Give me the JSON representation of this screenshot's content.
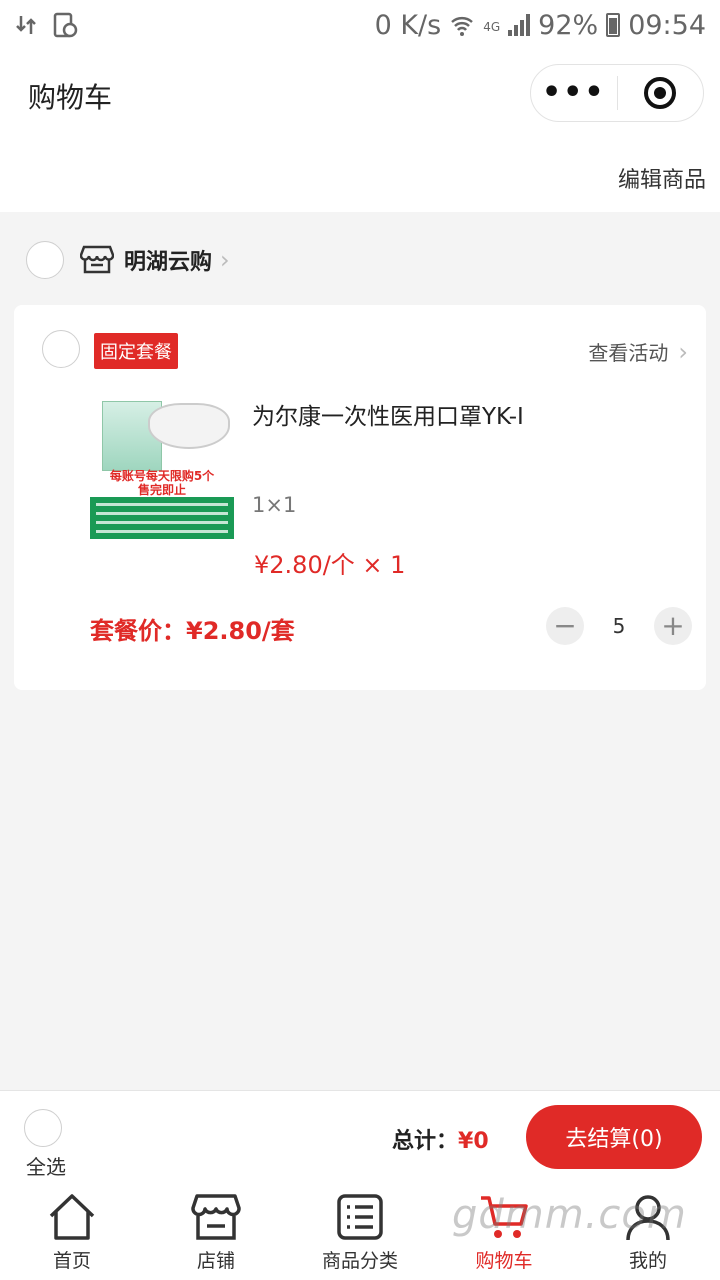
{
  "status_bar": {
    "speed": "0 K/s",
    "network": "4G",
    "battery": "92%",
    "time": "09:54"
  },
  "header": {
    "title": "购物车",
    "more_label": "•••",
    "edit_label": "编辑商品"
  },
  "shop": {
    "name": "明湖云购"
  },
  "package": {
    "badge": "固定套餐",
    "activity_link": "查看活动",
    "product": {
      "name": "为尔康一次性医用口罩YK-I",
      "image_promo": "每账号每天限购5个\n售完即止",
      "spec": "1×1",
      "unit_price": "¥2.80/个 × 1"
    },
    "set_price": "套餐价：¥2.80/套",
    "quantity": "5",
    "minus_label": "−",
    "plus_label": "+"
  },
  "checkout": {
    "select_all": "全选",
    "total_label": "总计：",
    "total_value": "¥0",
    "pay_button": "去结算(0)"
  },
  "tabbar": {
    "items": [
      {
        "label": "首页",
        "icon": "home-icon"
      },
      {
        "label": "店铺",
        "icon": "store-icon"
      },
      {
        "label": "商品分类",
        "icon": "list-icon"
      },
      {
        "label": "购物车",
        "icon": "cart-icon",
        "active": true
      },
      {
        "label": "我的",
        "icon": "user-icon"
      }
    ]
  },
  "watermark": "gdmm.com",
  "colors": {
    "accent": "#e02a27",
    "text": "#333333",
    "background": "#f4f4f4"
  }
}
